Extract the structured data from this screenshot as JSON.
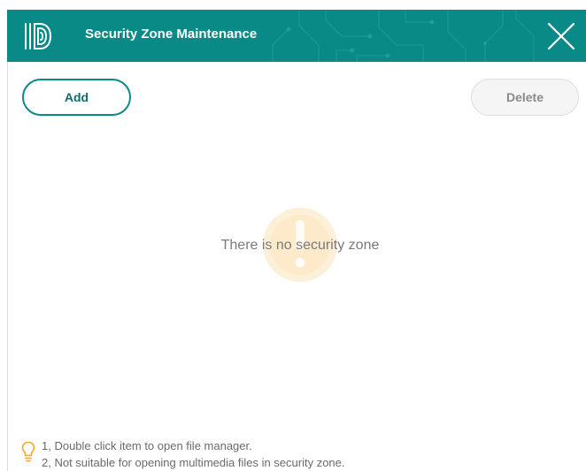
{
  "window": {
    "title": "Security Zone Maintenance",
    "accent_color": "#0a8a87",
    "logo_icon": "fingerprint-d-logo-icon",
    "close_icon": "close-icon"
  },
  "toolbar": {
    "add_label": "Add",
    "delete_label": "Delete",
    "delete_enabled": false
  },
  "main": {
    "empty_message": "There is no security zone",
    "empty_icon": "exclamation-icon",
    "empty_icon_color": "#fbe3b8"
  },
  "tips": {
    "icon": "lightbulb-icon",
    "icon_color": "#f0a830",
    "items": [
      "1, Double click item to open file manager.",
      "2, Not suitable for opening multimedia files in security zone."
    ]
  }
}
